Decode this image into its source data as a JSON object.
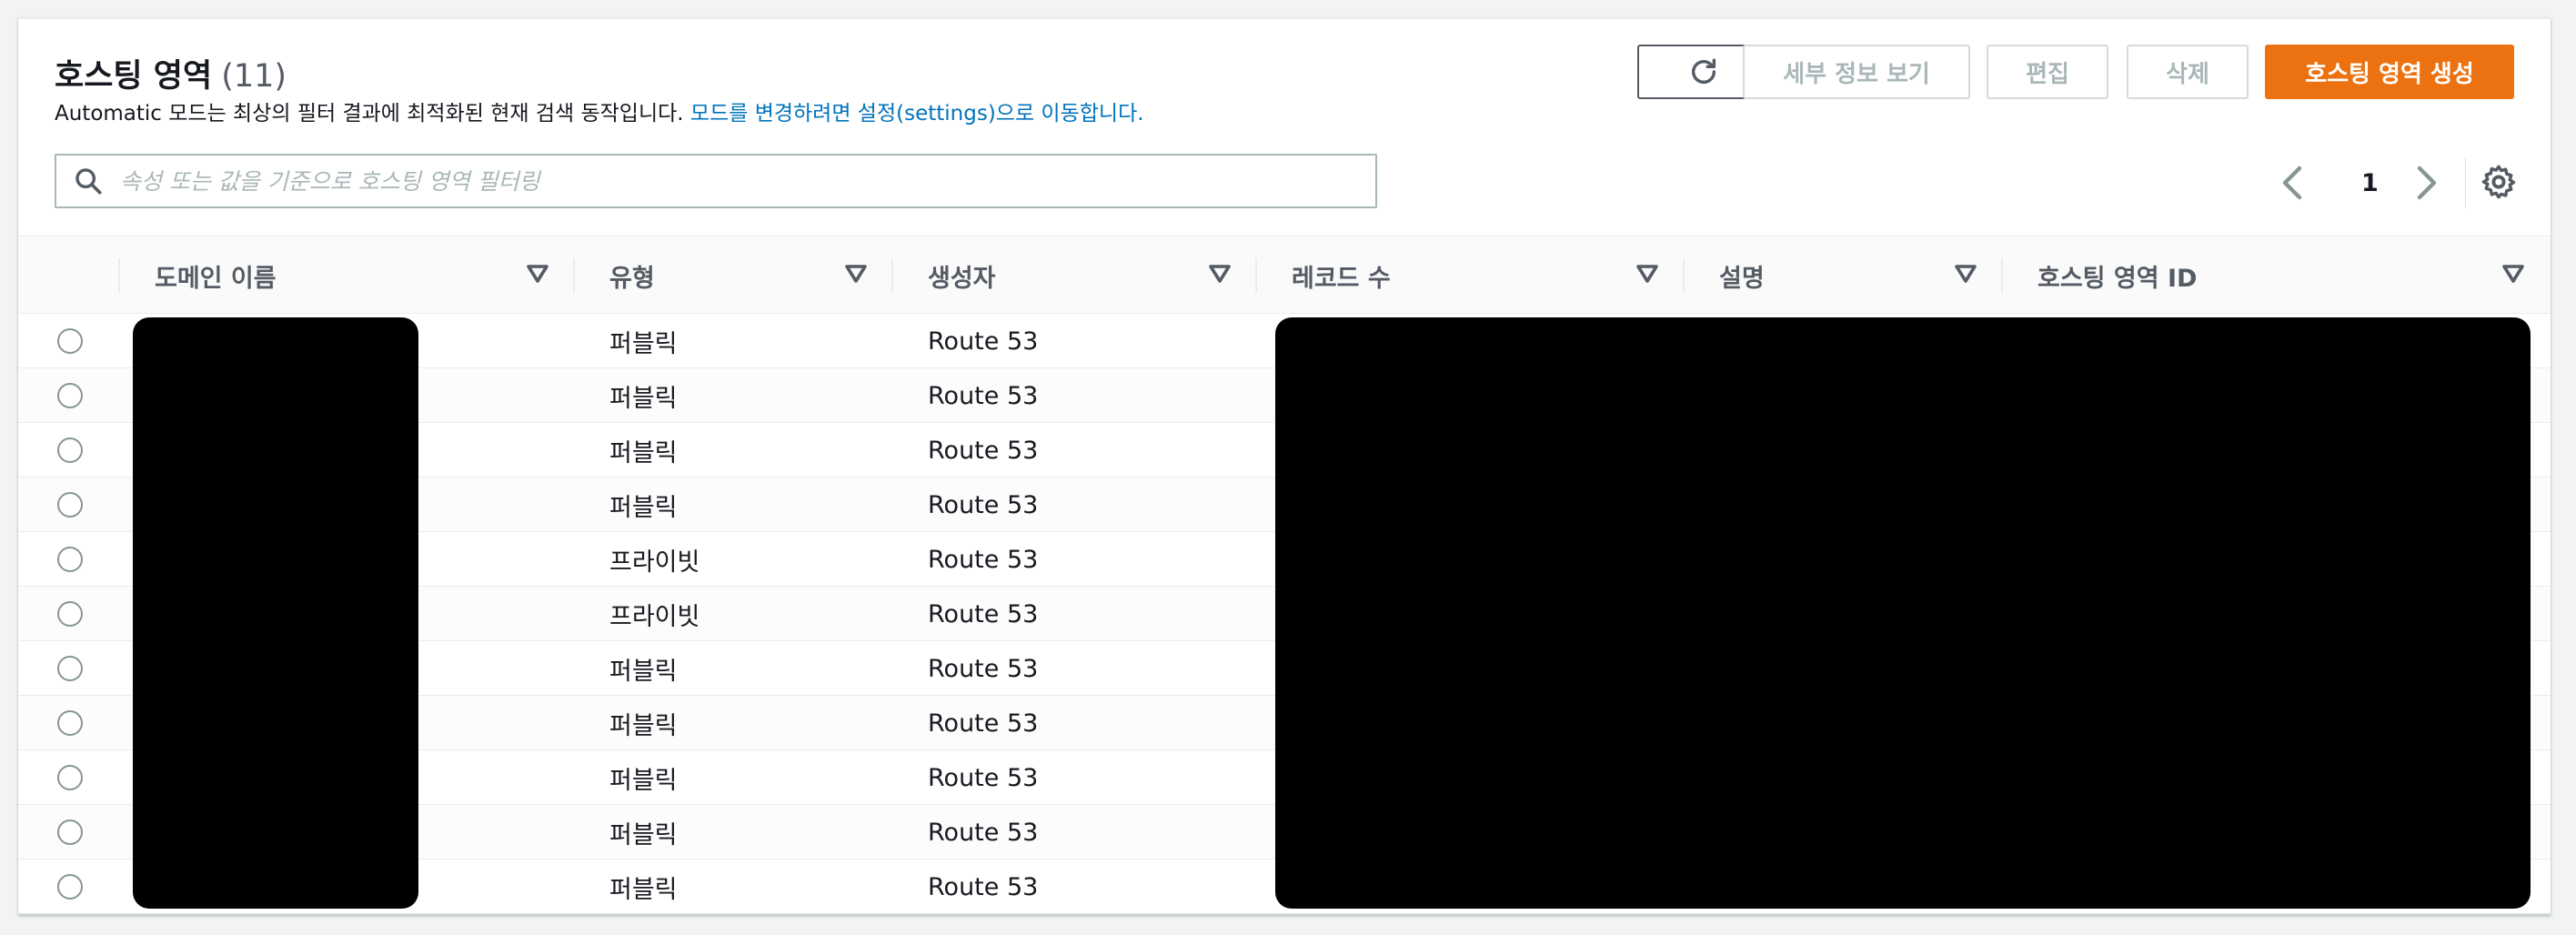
{
  "header": {
    "title": "호스팅 영역",
    "count": "(11)",
    "description": "Automatic 모드는 최상의 필터 결과에 최적화된 현재 검색 동작입니다.",
    "settings_link": "모드를 변경하려면 설정(settings)으로 이동합니다."
  },
  "toolbar": {
    "details_label": "세부 정보 보기",
    "edit_label": "편집",
    "delete_label": "삭제",
    "create_label": "호스팅 영역 생성"
  },
  "search": {
    "placeholder": "속성 또는 값을 기준으로 호스팅 영역 필터링"
  },
  "pagination": {
    "current_page": "1"
  },
  "table": {
    "columns": [
      "도메인 이름",
      "유형",
      "생성자",
      "레코드 수",
      "설명",
      "호스팅 영역 ID"
    ],
    "rows": [
      {
        "type": "퍼블릭",
        "created_by": "Route 53"
      },
      {
        "type": "퍼블릭",
        "created_by": "Route 53"
      },
      {
        "type": "퍼블릭",
        "created_by": "Route 53"
      },
      {
        "type": "퍼블릭",
        "created_by": "Route 53"
      },
      {
        "type": "프라이빗",
        "created_by": "Route 53"
      },
      {
        "type": "프라이빗",
        "created_by": "Route 53"
      },
      {
        "type": "퍼블릭",
        "created_by": "Route 53"
      },
      {
        "type": "퍼블릭",
        "created_by": "Route 53"
      },
      {
        "type": "퍼블릭",
        "created_by": "Route 53"
      },
      {
        "type": "퍼블릭",
        "created_by": "Route 53"
      },
      {
        "type": "퍼블릭",
        "created_by": "Route 53"
      }
    ]
  },
  "icons": {
    "refresh": "refresh-icon",
    "search": "search-icon",
    "prev": "chevron-left-icon",
    "next": "chevron-right-icon",
    "settings": "gear-icon",
    "sort": "sort-caret-icon"
  },
  "colors": {
    "primary": "#ec7211",
    "link": "#0073bb",
    "redaction": "#000000"
  }
}
